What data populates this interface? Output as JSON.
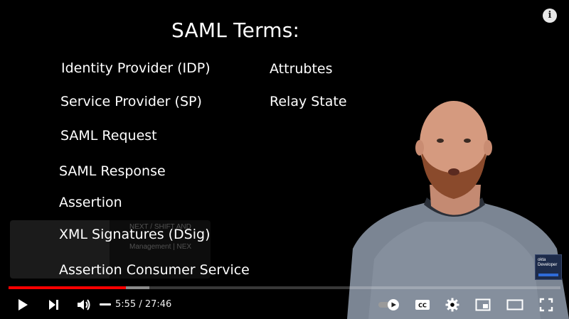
{
  "slide": {
    "title": "SAML Terms:",
    "left_terms": [
      "Identity Provider (IDP)",
      "Service Provider (SP)",
      "SAML Request",
      "SAML Response",
      "Assertion",
      "XML Signatures (DSig)",
      "Assertion Consumer Service"
    ],
    "right_terms": [
      "Attrubtes",
      "Relay State"
    ]
  },
  "overlay_card": {
    "line1": "NEXT / SHIFT AND",
    "line2": "Management | NEX"
  },
  "watermark": {
    "text": "okta Developer"
  },
  "player": {
    "current_time": "5:55",
    "duration": "27:46",
    "time_display": "5:55 / 27:46",
    "progress_fraction": 0.213,
    "buffered_fraction": 0.255,
    "accent_color": "#ff0000"
  },
  "icons": {
    "info": "info-icon",
    "play": "play-icon",
    "next": "next-icon",
    "volume": "volume-icon",
    "autoplay": "autoplay-toggle-icon",
    "captions": "captions-icon",
    "settings": "gear-icon",
    "miniplayer": "miniplayer-icon",
    "theater": "theater-mode-icon",
    "fullscreen": "fullscreen-icon"
  }
}
